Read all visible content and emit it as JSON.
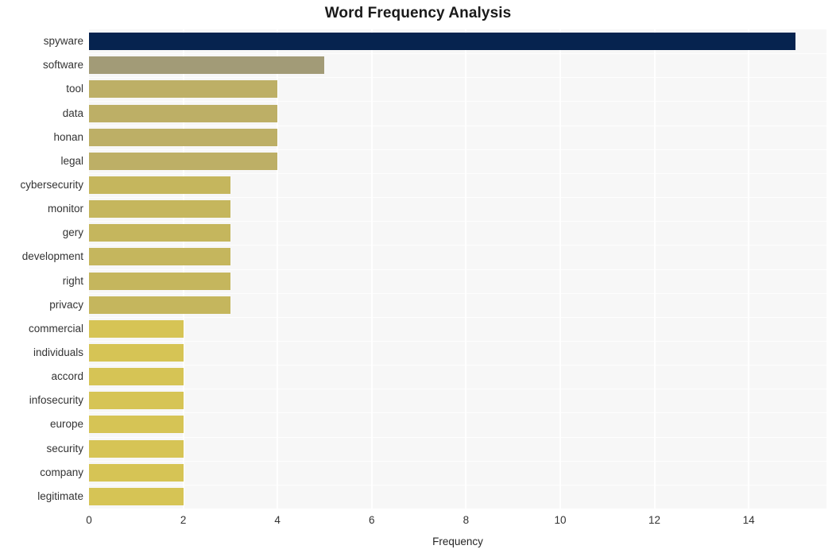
{
  "chart_data": {
    "type": "bar",
    "orientation": "horizontal",
    "title": "Word Frequency Analysis",
    "xlabel": "Frequency",
    "ylabel": "",
    "categories": [
      "spyware",
      "software",
      "tool",
      "data",
      "honan",
      "legal",
      "cybersecurity",
      "monitor",
      "gery",
      "development",
      "right",
      "privacy",
      "commercial",
      "individuals",
      "accord",
      "infosecurity",
      "europe",
      "security",
      "company",
      "legitimate"
    ],
    "values": [
      15,
      5,
      4,
      4,
      4,
      4,
      3,
      3,
      3,
      3,
      3,
      3,
      2,
      2,
      2,
      2,
      2,
      2,
      2,
      2
    ],
    "bar_colors": [
      "#06234f",
      "#a29b77",
      "#bdaf66",
      "#bdaf66",
      "#bdaf66",
      "#bdaf66",
      "#c5b65d",
      "#c5b65d",
      "#c5b65d",
      "#c5b65d",
      "#c5b65d",
      "#c5b65d",
      "#d6c455",
      "#d6c455",
      "#d6c455",
      "#d6c455",
      "#d6c455",
      "#d6c455",
      "#d6c455",
      "#d6c455"
    ],
    "xticks": [
      0,
      2,
      4,
      6,
      8,
      10,
      12,
      14
    ],
    "xtick_labels": [
      "0",
      "2",
      "4",
      "6",
      "8",
      "10",
      "12",
      "14"
    ],
    "xlim": [
      0,
      15.65
    ],
    "grid": true,
    "grid_axis": "x",
    "legend": null,
    "plot_background": "#f7f7f7",
    "figure_background": "#ffffff"
  }
}
